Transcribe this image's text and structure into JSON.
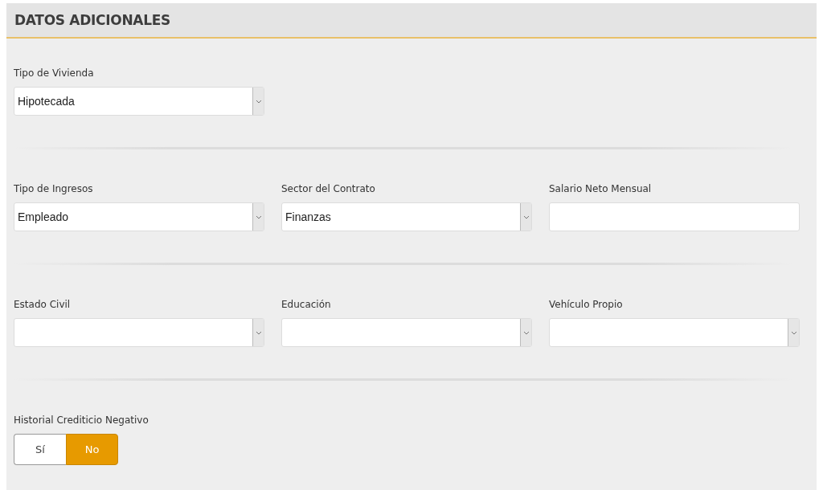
{
  "section": {
    "title": "DATOS ADICIONALES"
  },
  "rows": [
    [
      {
        "label": "Tipo de Vivienda",
        "kind": "select",
        "value": "Hipotecada"
      }
    ],
    [
      {
        "label": "Tipo de Ingresos",
        "kind": "select",
        "value": "Empleado"
      },
      {
        "label": "Sector del Contrato",
        "kind": "select",
        "value": "Finanzas"
      },
      {
        "label": "Salario Neto Mensual",
        "kind": "text"
      }
    ],
    [
      {
        "label": "Estado Civil",
        "kind": "select"
      },
      {
        "label": "Educación",
        "kind": "select"
      },
      {
        "label": "Vehículo Propio",
        "kind": "select"
      }
    ]
  ],
  "toggle": {
    "label": "Historial Crediticio Negativo",
    "options": [
      {
        "label": "Sí",
        "selected": false
      },
      {
        "label": "No",
        "selected": true
      }
    ]
  }
}
